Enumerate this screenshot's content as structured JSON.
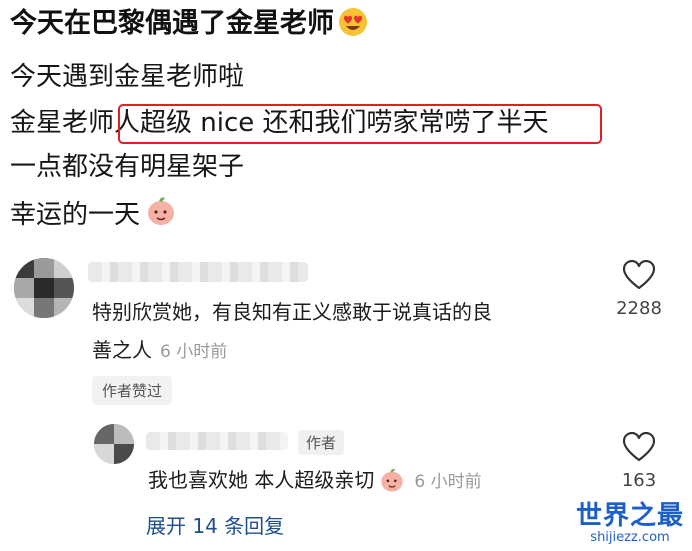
{
  "post": {
    "title": "今天在巴黎偶遇了金星老师",
    "lines": [
      "今天遇到金星老师啦",
      "金星老师人超级 nice 还和我们唠家常唠了半天",
      "一点都没有明星架子",
      "幸运的一天"
    ],
    "title_emoji": "heart-eyes-emoji",
    "line_emoji": "peach-emoji"
  },
  "comments": [
    {
      "text_line1": "特别欣赏她，有良知有正义感敢于说真话的良",
      "text_line2": "善之人",
      "time": "6 小时前",
      "likes": "2288",
      "liked_by_author_label": "作者赞过"
    }
  ],
  "reply": {
    "author_tag": "作者",
    "text": "我也喜欢她 本人超级亲切",
    "time": "6 小时前",
    "likes": "163"
  },
  "expand_label": "展开 14 条回复",
  "watermark": {
    "title": "世界之最",
    "domain": "shijiezz.com"
  },
  "colors": {
    "highlight": "#e02020",
    "link": "#1f4e8c",
    "brand": "#1d5fc9"
  }
}
